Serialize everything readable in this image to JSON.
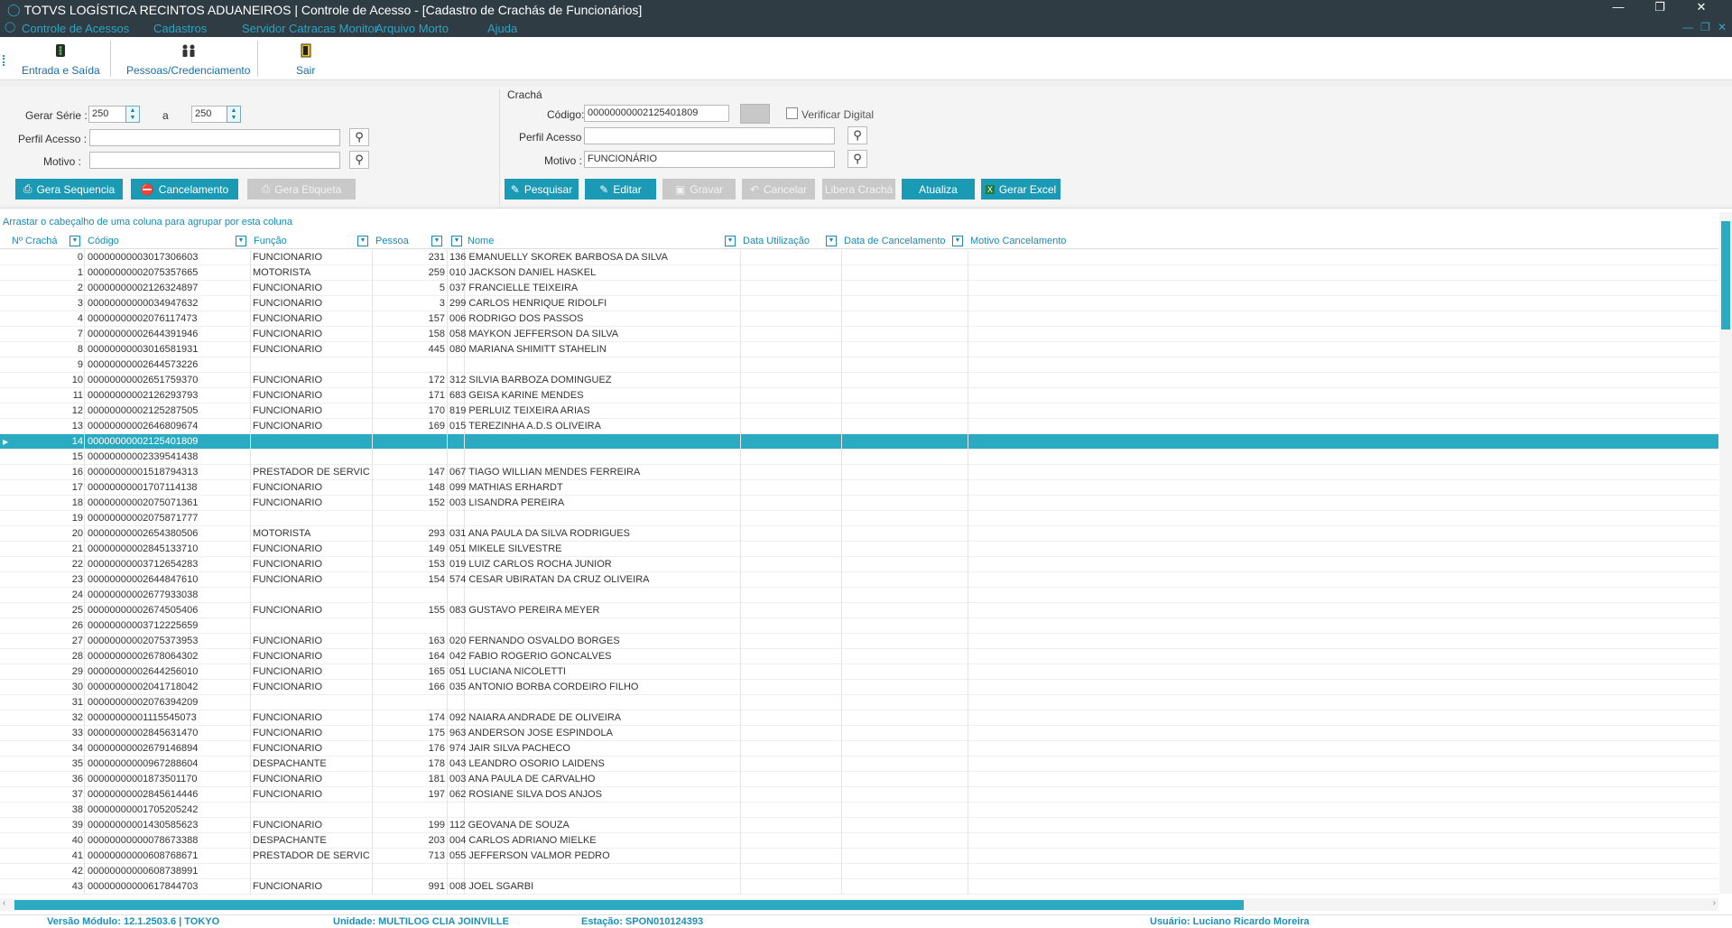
{
  "window": {
    "title": "TOTVS LOGÍSTICA RECINTOS ADUANEIROS | Controle de Acesso - [Cadastro de Crachás de Funcionários]",
    "controls": [
      "—",
      "❐",
      "✕"
    ]
  },
  "menu": {
    "items": [
      "Controle de Acessos",
      "Cadastros",
      "Servidor Catracas Monitor",
      "Arquivo Morto",
      "Ajuda"
    ],
    "mdi_controls": [
      "—",
      "❐",
      "✕"
    ]
  },
  "toolbar": {
    "entrada": "Entrada e Saída",
    "pessoas": "Pessoas/Credenciamento",
    "sair": "Sair"
  },
  "left_form": {
    "gerar_serie_label": "Gerar Série :",
    "serie_from": "250",
    "a_label": "a",
    "serie_to": "250",
    "perfil_label": "Perfil Acesso :",
    "perfil_value": "",
    "motivo_label": "Motivo :",
    "motivo_value": "",
    "btn_gera_sequencia": "Gera Sequencia",
    "btn_cancelamento": "Cancelamento",
    "btn_gera_etiqueta": "Gera Etiqueta"
  },
  "right_form": {
    "group_label": "Crachá",
    "codigo_label": "Código:",
    "codigo_value": "00000000002125401809",
    "verificar_label": "Verificar Digital",
    "verificar_checked": false,
    "perfil_label": "Perfil Acesso :",
    "perfil_value": "",
    "motivo_label": "Motivo :",
    "motivo_value": "FUNCIONÁRIO",
    "btn_pesquisar": "Pesquisar",
    "btn_editar": "Editar",
    "btn_gravar": "Gravar",
    "btn_cancelar": "Cancelar",
    "btn_libera": "Libera Crachá",
    "btn_atualiza": "Atualiza",
    "btn_excel": "Gerar Excel"
  },
  "grid": {
    "group_hint": "Arrastar o cabeçalho de uma coluna para agrupar por esta coluna",
    "columns": [
      "Nº Crachá",
      "Código",
      "Função",
      "Pessoa",
      "Nome",
      "Data Utilização",
      "Data de Cancelamento",
      "Motivo Cancelamento"
    ],
    "selected_index": 14,
    "rows": [
      [
        "0",
        "00000000003017306603",
        "FUNCIONARIO",
        "231",
        "136 EMANUELLY SKOREK BARBOSA DA SILVA"
      ],
      [
        "1",
        "00000000002075357665",
        "MOTORISTA",
        "259",
        "010 JACKSON DANIEL HASKEL"
      ],
      [
        "2",
        "00000000002126324897",
        "FUNCIONARIO",
        "5",
        "037 FRANCIELLE TEIXEIRA"
      ],
      [
        "3",
        "00000000000034947632",
        "FUNCIONARIO",
        "3",
        "299 CARLOS HENRIQUE RIDOLFI"
      ],
      [
        "4",
        "00000000002076117473",
        "FUNCIONARIO",
        "157",
        "006 RODRIGO DOS PASSOS"
      ],
      [
        "7",
        "00000000002644391946",
        "FUNCIONARIO",
        "158",
        "058 MAYKON JEFFERSON DA SILVA"
      ],
      [
        "8",
        "00000000003016581931",
        "FUNCIONARIO",
        "445",
        "080 MARIANA SHIMITT STAHELIN"
      ],
      [
        "9",
        "00000000002644573226",
        "",
        "",
        ""
      ],
      [
        "10",
        "00000000002651759370",
        "FUNCIONARIO",
        "172",
        "312 SILVIA BARBOZA DOMINGUEZ"
      ],
      [
        "11",
        "00000000002126293793",
        "FUNCIONARIO",
        "171",
        "683 GEISA KARINE MENDES"
      ],
      [
        "12",
        "00000000002125287505",
        "FUNCIONARIO",
        "170",
        "819 PERLUIZ TEIXEIRA ARIAS"
      ],
      [
        "13",
        "00000000002646809674",
        "FUNCIONARIO",
        "169",
        "015 TEREZINHA A.D.S OLIVEIRA"
      ],
      [
        "14",
        "00000000002125401809",
        "",
        "",
        ""
      ],
      [
        "15",
        "00000000002339541438",
        "",
        "",
        ""
      ],
      [
        "16",
        "00000000001518794313",
        "PRESTADOR DE SERVICOS",
        "147",
        "067 TIAGO WILLIAN MENDES FERREIRA"
      ],
      [
        "17",
        "00000000001707114138",
        "FUNCIONARIO",
        "148",
        "099 MATHIAS ERHARDT"
      ],
      [
        "18",
        "00000000002075071361",
        "FUNCIONARIO",
        "152",
        "003 LISANDRA PEREIRA"
      ],
      [
        "19",
        "00000000002075871777",
        "",
        "",
        ""
      ],
      [
        "20",
        "00000000002654380506",
        "MOTORISTA",
        "293",
        "031 ANA PAULA DA SILVA RODRIGUES"
      ],
      [
        "21",
        "00000000002845133710",
        "FUNCIONARIO",
        "149",
        "051 MIKELE SILVESTRE"
      ],
      [
        "22",
        "00000000003712654283",
        "FUNCIONARIO",
        "153",
        "019 LUIZ CARLOS ROCHA JUNIOR"
      ],
      [
        "23",
        "00000000002644847610",
        "FUNCIONARIO",
        "154",
        "574 CESAR UBIRATAN DA CRUZ OLIVEIRA"
      ],
      [
        "24",
        "00000000002677933038",
        "",
        "",
        ""
      ],
      [
        "25",
        "00000000002674505406",
        "FUNCIONARIO",
        "155",
        "083 GUSTAVO PEREIRA MEYER"
      ],
      [
        "26",
        "00000000003712225659",
        "",
        "",
        ""
      ],
      [
        "27",
        "00000000002075373953",
        "FUNCIONARIO",
        "163",
        "020 FERNANDO OSVALDO BORGES"
      ],
      [
        "28",
        "00000000002678064302",
        "FUNCIONARIO",
        "164",
        "042 FABIO ROGERIO GONCALVES"
      ],
      [
        "29",
        "00000000002644256010",
        "FUNCIONARIO",
        "165",
        "051 LUCIANA NICOLETTI"
      ],
      [
        "30",
        "00000000002041718042",
        "FUNCIONARIO",
        "166",
        "035 ANTONIO BORBA CORDEIRO FILHO"
      ],
      [
        "31",
        "00000000002076394209",
        "",
        "",
        ""
      ],
      [
        "32",
        "00000000001115545073",
        "FUNCIONARIO",
        "174",
        "092 NAIARA ANDRADE DE OLIVEIRA"
      ],
      [
        "33",
        "00000000002845631470",
        "FUNCIONARIO",
        "175",
        "963 ANDERSON JOSE ESPINDOLA"
      ],
      [
        "34",
        "00000000002679146894",
        "FUNCIONARIO",
        "176",
        "974 JAIR SILVA PACHECO"
      ],
      [
        "35",
        "00000000000967288604",
        "DESPACHANTE",
        "178",
        "043 LEANDRO OSORIO LAIDENS"
      ],
      [
        "36",
        "00000000001873501170",
        "FUNCIONARIO",
        "181",
        "003 ANA PAULA DE CARVALHO"
      ],
      [
        "37",
        "00000000002845614446",
        "FUNCIONARIO",
        "197",
        "062 ROSIANE SILVA DOS ANJOS"
      ],
      [
        "38",
        "00000000001705205242",
        "",
        "",
        ""
      ],
      [
        "39",
        "00000000001430585623",
        "FUNCIONARIO",
        "199",
        "112 GEOVANA DE SOUZA"
      ],
      [
        "40",
        "00000000000078673388",
        "DESPACHANTE",
        "203",
        "004 CARLOS ADRIANO MIELKE"
      ],
      [
        "41",
        "00000000000608768671",
        "PRESTADOR DE SERVICOS",
        "713",
        "055 JEFFERSON VALMOR PEDRO"
      ],
      [
        "42",
        "00000000000608738991",
        "",
        "",
        ""
      ],
      [
        "43",
        "00000000000617844703",
        "FUNCIONARIO",
        "991",
        "008 JOEL SGARBI"
      ]
    ]
  },
  "status": {
    "versao": "Versão Módulo:  12.1.2503.6  |  TOKYO",
    "unidade": "Unidade: MULTILOG CLIA JOINVILLE",
    "estacao": "Estação: SPON010124393",
    "usuario": "Usuário: Luciano Ricardo Moreira"
  }
}
